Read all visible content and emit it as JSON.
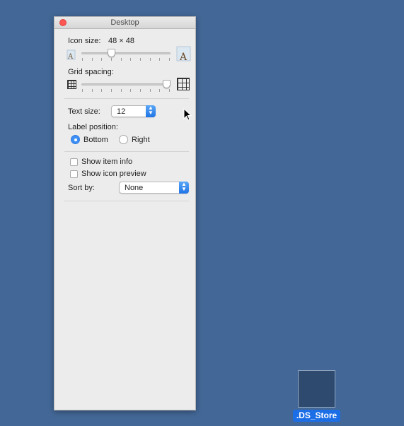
{
  "panel": {
    "title": "Desktop",
    "icon_size": {
      "label": "Icon size:",
      "value": "48 × 48",
      "slider_fraction": 0.32
    },
    "grid_spacing": {
      "label": "Grid spacing:",
      "slider_fraction": 1.0
    },
    "text_size": {
      "label": "Text size:",
      "value": "12"
    },
    "label_position": {
      "label": "Label position:",
      "options": [
        {
          "label": "Bottom",
          "selected": true
        },
        {
          "label": "Right",
          "selected": false
        }
      ]
    },
    "show_item_info": {
      "label": "Show item info",
      "checked": false
    },
    "show_icon_preview": {
      "label": "Show icon preview",
      "checked": false
    },
    "sort_by": {
      "label": "Sort by:",
      "value": "None"
    }
  },
  "desktop": {
    "file_label": ".DS_Store",
    "background_color": "#436897",
    "selection_color": "#1c6ee6"
  },
  "colors": {
    "accent": "#3d8ff5",
    "close_button": "#fc5753"
  }
}
